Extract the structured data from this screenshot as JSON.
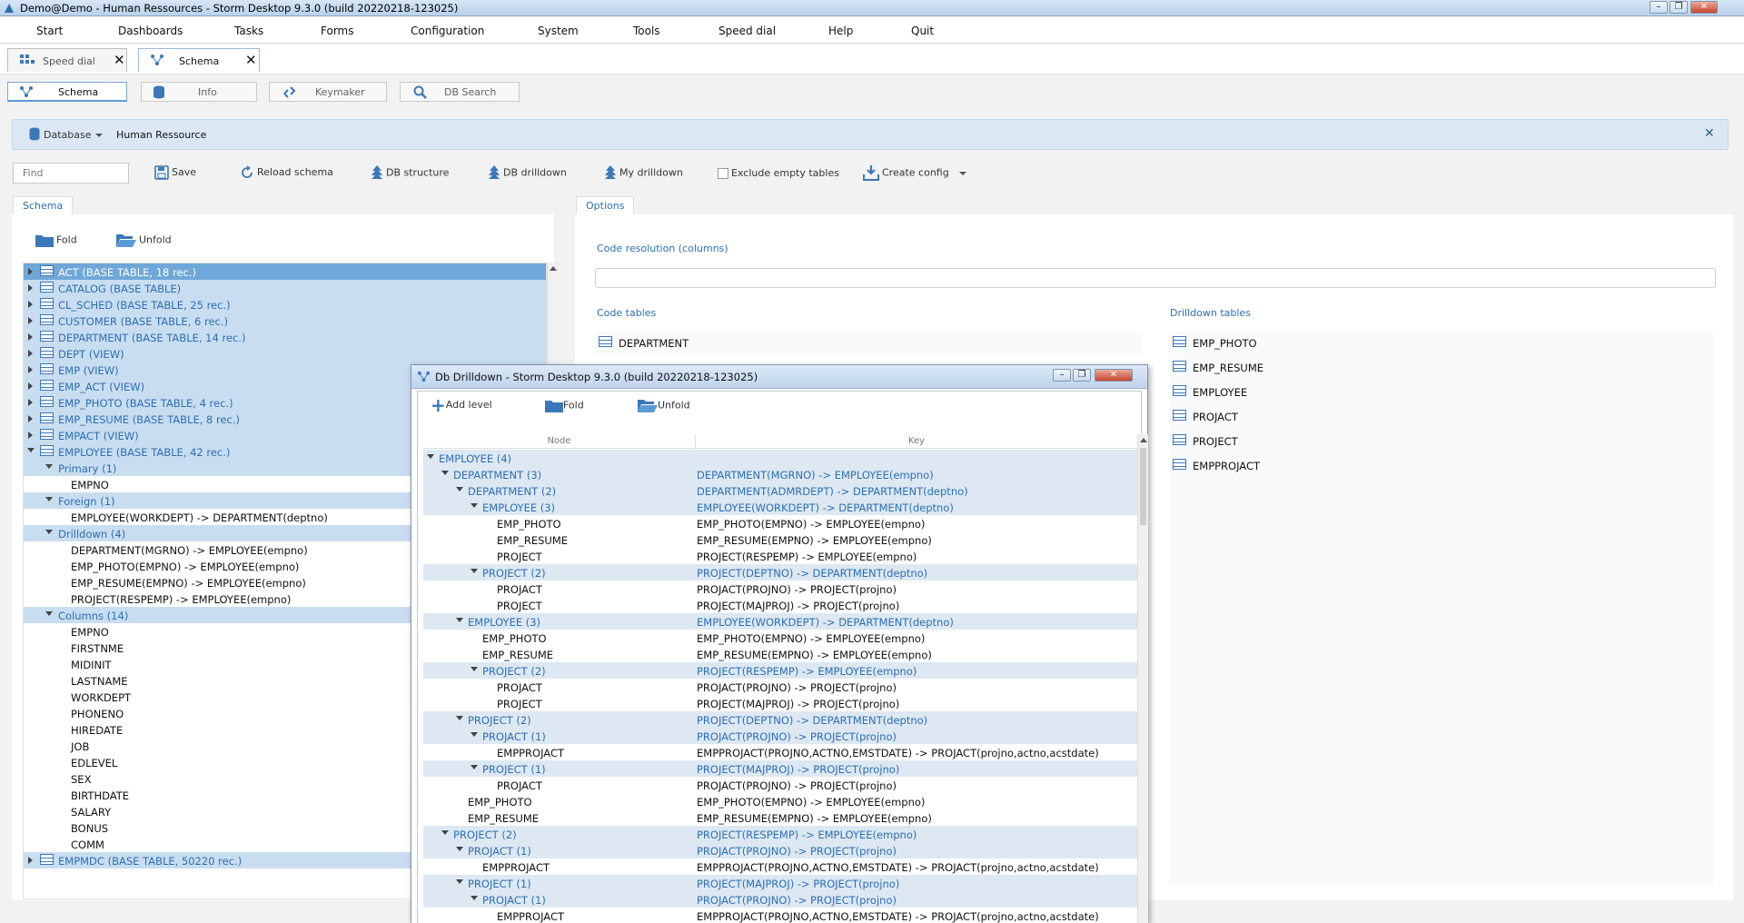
{
  "window": {
    "title": "Demo@Demo - Human Ressources - Storm Desktop 9.3.0 (build 20220218-123025)"
  },
  "menu": [
    "Start",
    "Dashboards",
    "Tasks",
    "Forms",
    "Configuration",
    "System",
    "Tools",
    "Speed dial",
    "Help",
    "Quit"
  ],
  "doc_tabs": [
    {
      "label": "Speed dial"
    },
    {
      "label": "Schema"
    }
  ],
  "sub_tabs": [
    {
      "label": "Schema"
    },
    {
      "label": "Info"
    },
    {
      "label": "Keymaker"
    },
    {
      "label": "DB Search"
    }
  ],
  "database_bar": {
    "label": "Database",
    "value": "Human Ressource"
  },
  "toolbar": {
    "find_placeholder": "Find",
    "save": "Save",
    "reload": "Reload schema",
    "db_structure": "DB structure",
    "db_drilldown": "DB drilldown",
    "my_drilldown": "My drilldown",
    "exclude_empty": "Exclude empty tables",
    "create_config": "Create config"
  },
  "schema_panel": {
    "tab": "Schema",
    "fold": "Fold",
    "unfold": "Unfold",
    "tree": [
      {
        "text": "ACT (BASE TABLE, 18 rec.)",
        "level": 0,
        "icon": true,
        "exp": "r",
        "style": "sel"
      },
      {
        "text": "CATALOG (BASE TABLE)",
        "level": 0,
        "icon": true,
        "exp": "r",
        "style": "hl"
      },
      {
        "text": "CL_SCHED (BASE TABLE, 25 rec.)",
        "level": 0,
        "icon": true,
        "exp": "r",
        "style": "hl"
      },
      {
        "text": "CUSTOMER (BASE TABLE, 6 rec.)",
        "level": 0,
        "icon": true,
        "exp": "r",
        "style": "hl"
      },
      {
        "text": "DEPARTMENT (BASE TABLE, 14 rec.)",
        "level": 0,
        "icon": true,
        "exp": "r",
        "style": "hl"
      },
      {
        "text": "DEPT (VIEW)",
        "level": 0,
        "icon": true,
        "exp": "r",
        "style": "hl"
      },
      {
        "text": "EMP (VIEW)",
        "level": 0,
        "icon": true,
        "exp": "r",
        "style": "hl"
      },
      {
        "text": "EMP_ACT (VIEW)",
        "level": 0,
        "icon": true,
        "exp": "r",
        "style": "hl"
      },
      {
        "text": "EMP_PHOTO (BASE TABLE, 4 rec.)",
        "level": 0,
        "icon": true,
        "exp": "r",
        "style": "hl"
      },
      {
        "text": "EMP_RESUME (BASE TABLE, 8 rec.)",
        "level": 0,
        "icon": true,
        "exp": "r",
        "style": "hl"
      },
      {
        "text": "EMPACT (VIEW)",
        "level": 0,
        "icon": true,
        "exp": "r",
        "style": "hl"
      },
      {
        "text": "EMPLOYEE (BASE TABLE, 42 rec.)",
        "level": 0,
        "icon": true,
        "exp": "d",
        "style": "hl"
      },
      {
        "text": "Primary (1)",
        "level": 1,
        "exp": "d",
        "style": "hlb"
      },
      {
        "text": "EMPNO",
        "level": 2
      },
      {
        "text": "Foreign (1)",
        "level": 1,
        "exp": "d",
        "style": "hlb"
      },
      {
        "text": "EMPLOYEE(WORKDEPT) -> DEPARTMENT(deptno)",
        "level": 2
      },
      {
        "text": "Drilldown (4)",
        "level": 1,
        "exp": "d",
        "style": "hlb"
      },
      {
        "text": "DEPARTMENT(MGRNO) -> EMPLOYEE(empno)",
        "level": 2
      },
      {
        "text": "EMP_PHOTO(EMPNO) -> EMPLOYEE(empno)",
        "level": 2
      },
      {
        "text": "EMP_RESUME(EMPNO) -> EMPLOYEE(empno)",
        "level": 2
      },
      {
        "text": "PROJECT(RESPEMP) -> EMPLOYEE(empno)",
        "level": 2
      },
      {
        "text": "Columns (14)",
        "level": 1,
        "exp": "d",
        "style": "hlb"
      },
      {
        "text": "EMPNO",
        "level": 2
      },
      {
        "text": "FIRSTNME",
        "level": 2
      },
      {
        "text": "MIDINIT",
        "level": 2
      },
      {
        "text": "LASTNAME",
        "level": 2
      },
      {
        "text": "WORKDEPT",
        "level": 2
      },
      {
        "text": "PHONENO",
        "level": 2
      },
      {
        "text": "HIREDATE",
        "level": 2
      },
      {
        "text": "JOB",
        "level": 2
      },
      {
        "text": "EDLEVEL",
        "level": 2
      },
      {
        "text": "SEX",
        "level": 2
      },
      {
        "text": "BIRTHDATE",
        "level": 2
      },
      {
        "text": "SALARY",
        "level": 2
      },
      {
        "text": "BONUS",
        "level": 2
      },
      {
        "text": "COMM",
        "level": 2
      },
      {
        "text": "EMPMDC (BASE TABLE, 50220 rec.)",
        "level": 0,
        "icon": true,
        "exp": "r",
        "style": "hl"
      }
    ]
  },
  "options_panel": {
    "tab": "Options",
    "code_resolution_label": "Code resolution (columns)",
    "code_tables_label": "Code tables",
    "drilldown_tables_label": "Drilldown tables",
    "code_tables": [
      "DEPARTMENT"
    ],
    "drilldown_tables": [
      "EMP_PHOTO",
      "EMP_RESUME",
      "EMPLOYEE",
      "PROJACT",
      "PROJECT",
      "EMPPROJACT"
    ]
  },
  "dialog": {
    "title": "Db Drilldown - Storm Desktop 9.3.0 (build 20220218-123025)",
    "add_level": "Add level",
    "fold": "Fold",
    "unfold": "Unfold",
    "col_node": "Node",
    "col_key": "Key",
    "rows": [
      {
        "node": "EMPLOYEE (4)",
        "key": "",
        "level": 0,
        "exp": "d",
        "hl": true
      },
      {
        "node": "DEPARTMENT (3)",
        "key": "DEPARTMENT(MGRNO) -> EMPLOYEE(empno)",
        "level": 1,
        "exp": "d",
        "hl": true
      },
      {
        "node": "DEPARTMENT (2)",
        "key": "DEPARTMENT(ADMRDEPT) -> DEPARTMENT(deptno)",
        "level": 2,
        "exp": "d",
        "hl": true
      },
      {
        "node": "EMPLOYEE (3)",
        "key": "EMPLOYEE(WORKDEPT) -> DEPARTMENT(deptno)",
        "level": 3,
        "exp": "d",
        "hl": true
      },
      {
        "node": "EMP_PHOTO",
        "key": "EMP_PHOTO(EMPNO) -> EMPLOYEE(empno)",
        "level": 4
      },
      {
        "node": "EMP_RESUME",
        "key": "EMP_RESUME(EMPNO) -> EMPLOYEE(empno)",
        "level": 4
      },
      {
        "node": "PROJECT",
        "key": "PROJECT(RESPEMP) -> EMPLOYEE(empno)",
        "level": 4
      },
      {
        "node": "PROJECT (2)",
        "key": "PROJECT(DEPTNO) -> DEPARTMENT(deptno)",
        "level": 3,
        "exp": "d",
        "hl": true
      },
      {
        "node": "PROJACT",
        "key": "PROJACT(PROJNO) -> PROJECT(projno)",
        "level": 4
      },
      {
        "node": "PROJECT",
        "key": "PROJECT(MAJPROJ) -> PROJECT(projno)",
        "level": 4
      },
      {
        "node": "EMPLOYEE (3)",
        "key": "EMPLOYEE(WORKDEPT) -> DEPARTMENT(deptno)",
        "level": 2,
        "exp": "d",
        "hl": true
      },
      {
        "node": "EMP_PHOTO",
        "key": "EMP_PHOTO(EMPNO) -> EMPLOYEE(empno)",
        "level": 3
      },
      {
        "node": "EMP_RESUME",
        "key": "EMP_RESUME(EMPNO) -> EMPLOYEE(empno)",
        "level": 3
      },
      {
        "node": "PROJECT (2)",
        "key": "PROJECT(RESPEMP) -> EMPLOYEE(empno)",
        "level": 3,
        "exp": "d",
        "hl": true
      },
      {
        "node": "PROJACT",
        "key": "PROJACT(PROJNO) -> PROJECT(projno)",
        "level": 4
      },
      {
        "node": "PROJECT",
        "key": "PROJECT(MAJPROJ) -> PROJECT(projno)",
        "level": 4
      },
      {
        "node": "PROJECT (2)",
        "key": "PROJECT(DEPTNO) -> DEPARTMENT(deptno)",
        "level": 2,
        "exp": "d",
        "hl": true
      },
      {
        "node": "PROJACT (1)",
        "key": "PROJACT(PROJNO) -> PROJECT(projno)",
        "level": 3,
        "exp": "d",
        "hl": true
      },
      {
        "node": "EMPPROJACT",
        "key": "EMPPROJACT(PROJNO,ACTNO,EMSTDATE) -> PROJACT(projno,actno,acstdate)",
        "level": 4
      },
      {
        "node": "PROJECT (1)",
        "key": "PROJECT(MAJPROJ) -> PROJECT(projno)",
        "level": 3,
        "exp": "d",
        "hl": true
      },
      {
        "node": "PROJACT",
        "key": "PROJACT(PROJNO) -> PROJECT(projno)",
        "level": 4
      },
      {
        "node": "EMP_PHOTO",
        "key": "EMP_PHOTO(EMPNO) -> EMPLOYEE(empno)",
        "level": 2
      },
      {
        "node": "EMP_RESUME",
        "key": "EMP_RESUME(EMPNO) -> EMPLOYEE(empno)",
        "level": 2
      },
      {
        "node": "PROJECT (2)",
        "key": "PROJECT(RESPEMP) -> EMPLOYEE(empno)",
        "level": 1,
        "exp": "d",
        "hl": true
      },
      {
        "node": "PROJACT (1)",
        "key": "PROJACT(PROJNO) -> PROJECT(projno)",
        "level": 2,
        "exp": "d",
        "hl": true
      },
      {
        "node": "EMPPROJACT",
        "key": "EMPPROJACT(PROJNO,ACTNO,EMSTDATE) -> PROJACT(projno,actno,acstdate)",
        "level": 3
      },
      {
        "node": "PROJECT (1)",
        "key": "PROJECT(MAJPROJ) -> PROJECT(projno)",
        "level": 2,
        "exp": "d",
        "hl": true
      },
      {
        "node": "PROJACT (1)",
        "key": "PROJACT(PROJNO) -> PROJECT(projno)",
        "level": 3,
        "exp": "d",
        "hl": true
      },
      {
        "node": "EMPPROJACT",
        "key": "EMPPROJACT(PROJNO,ACTNO,EMSTDATE) -> PROJACT(projno,actno,acstdate)",
        "level": 4
      }
    ]
  }
}
